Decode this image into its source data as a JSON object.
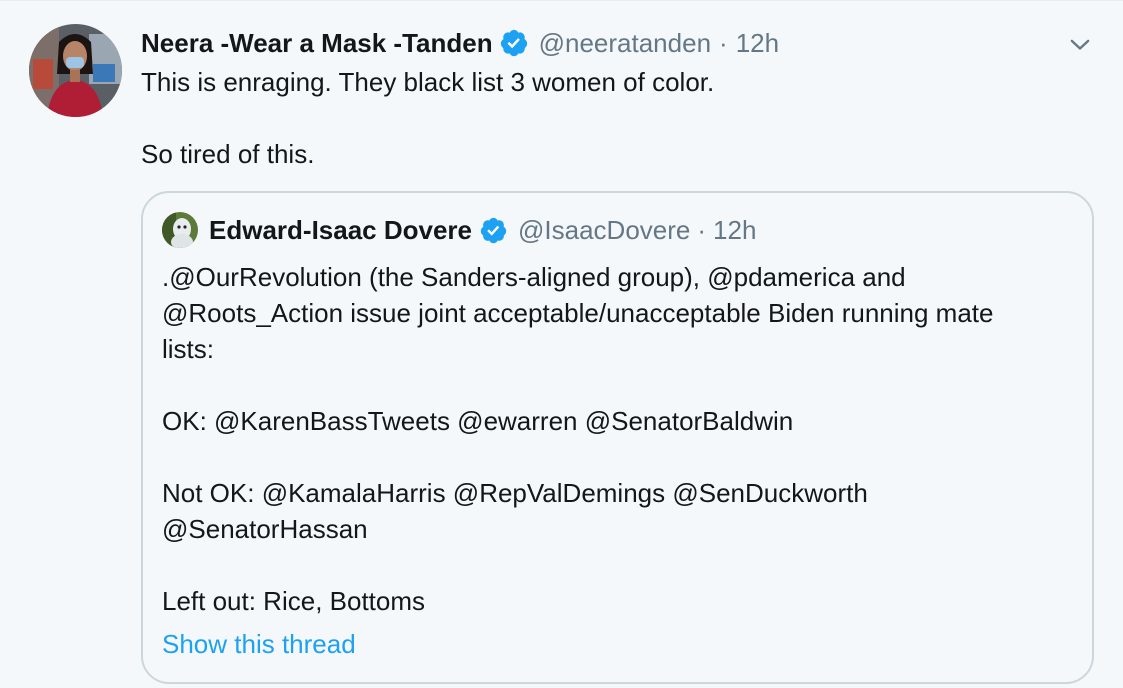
{
  "tweet": {
    "display_name": "Neera -Wear a Mask -Tanden",
    "handle": "@neeratanden",
    "separator": "·",
    "time": "12h",
    "verified": true,
    "text_line_1": "This is enraging. They black list 3 women of color.",
    "text_line_2": "So tired of this."
  },
  "quoted_tweet": {
    "display_name": "Edward-Isaac Dovere",
    "handle": "@IsaacDovere",
    "separator": "·",
    "time": "12h",
    "verified": true,
    "lines": [
      ".@OurRevolution (the Sanders-aligned group), @pdamerica and",
      "@Roots_Action issue joint acceptable/unacceptable Biden running mate",
      "lists:",
      "OK: @KarenBassTweets @ewarren @SenatorBaldwin",
      "Not OK: @KamalaHarris @RepValDemings @SenDuckworth",
      "@SenatorHassan",
      "Left out: Rice, Bottoms"
    ],
    "show_thread_label": "Show this thread"
  },
  "icons": {
    "verified": "verified-badge-icon",
    "caret": "chevron-down-icon"
  },
  "colors": {
    "background": "#f5f8fa",
    "text": "#14171a",
    "secondary_text": "#657786",
    "link": "#1da1f2",
    "verified": "#1da1f2",
    "border": "#ccd6dd"
  }
}
